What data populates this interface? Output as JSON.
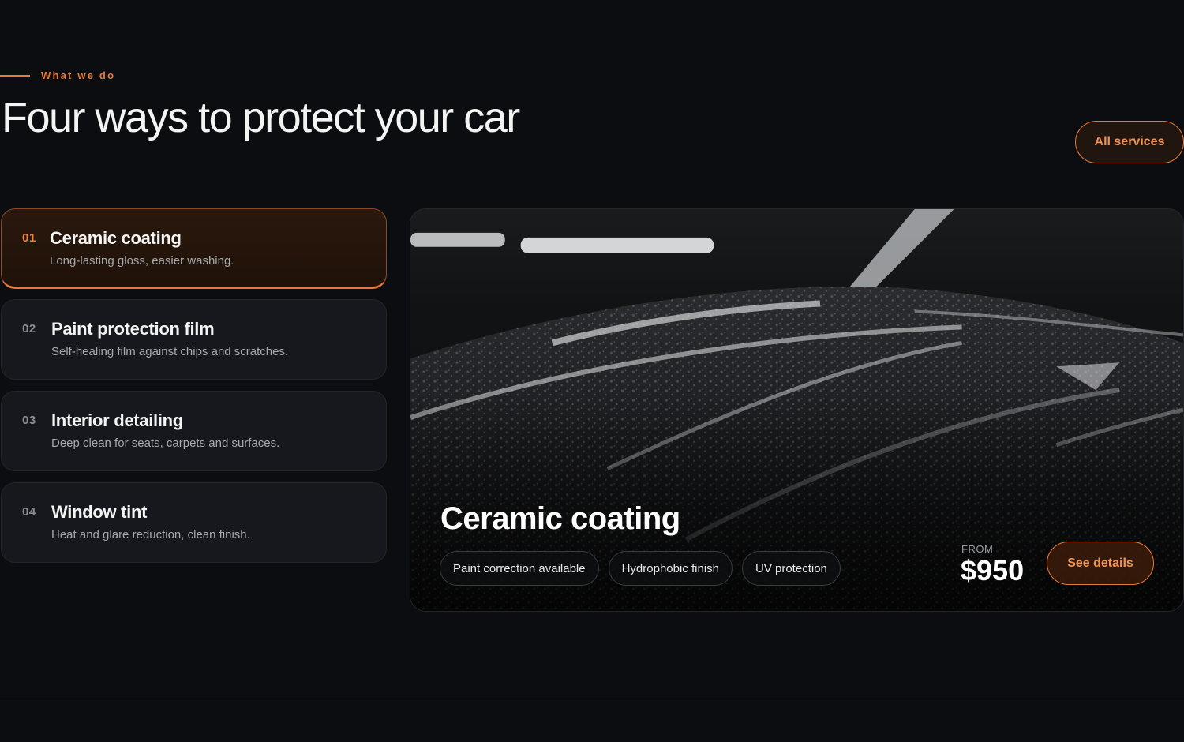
{
  "eyebrow": "What we do",
  "title": "Four ways to protect your car",
  "all_services_label": "All services",
  "services": [
    {
      "num": "01",
      "title": "Ceramic coating",
      "desc": "Long-lasting gloss, easier washing."
    },
    {
      "num": "02",
      "title": "Paint protection film",
      "desc": "Self-healing film against chips and scratches."
    },
    {
      "num": "03",
      "title": "Interior detailing",
      "desc": "Deep clean for seats, carpets and surfaces."
    },
    {
      "num": "04",
      "title": "Window tint",
      "desc": "Heat and glare reduction, clean finish."
    }
  ],
  "active_service": 0,
  "feature": {
    "title": "Ceramic coating",
    "tags": [
      "Paint correction available",
      "Hydrophobic finish",
      "UV protection"
    ],
    "from_label": "FROM",
    "price": "$950",
    "cta_label": "See details"
  },
  "colors": {
    "accent": "#e8793a",
    "background": "#0c0d10",
    "card": "#16181d"
  }
}
